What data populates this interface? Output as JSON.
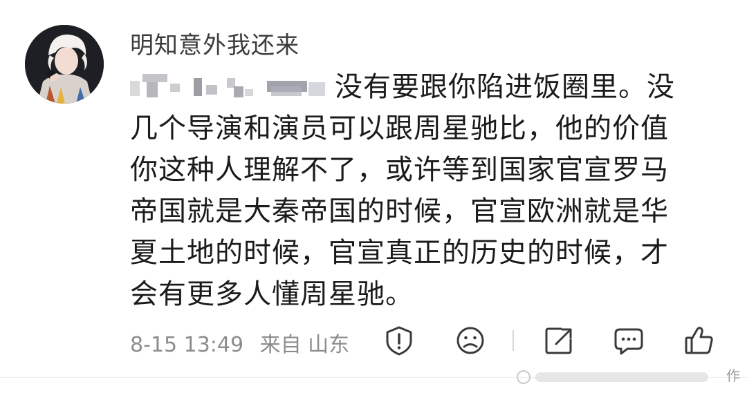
{
  "comment": {
    "username": "明知意外我还来",
    "lines": [
      "没有要跟你陷进饭圈里。没",
      "几个导演和演员可以跟周星驰比，他的价值",
      "你这种人理解不了，或许等到国家官宣罗马",
      "帝国就是大秦帝国的时候，官宣欧洲就是华",
      "夏土地的时候，官宣真正的历史的时候，才",
      "会有更多人懂周星驰。"
    ],
    "date": "8-15 13:49",
    "location": "来自 山东"
  },
  "actions": [
    "report-icon",
    "sad-face-icon",
    "share-icon",
    "comment-icon",
    "like-icon"
  ],
  "watermark": {
    "text": "作"
  },
  "colors": {
    "username": "#3c3c3c",
    "text": "#1b1b1b",
    "meta": "#8c8c8c"
  }
}
